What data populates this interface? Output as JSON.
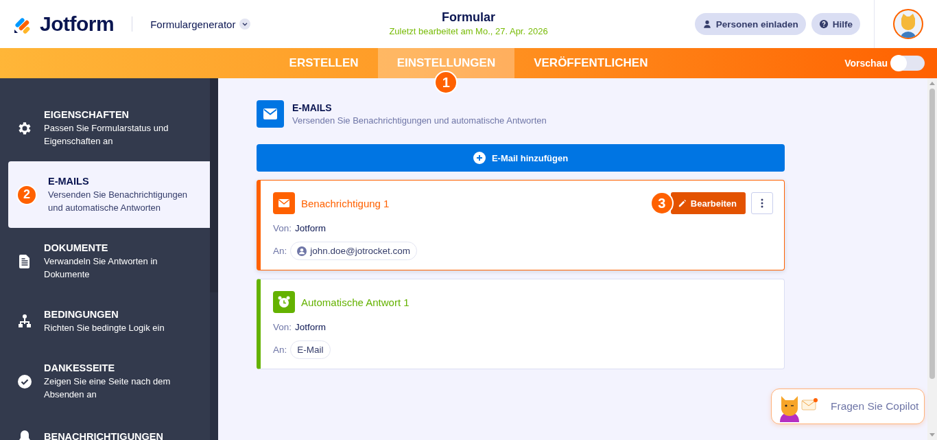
{
  "header": {
    "logo": "Jotform",
    "builder_menu": "Formulargenerator",
    "title": "Formular",
    "last_edited": "Zuletzt bearbeitet am Mo., 27. Apr. 2026",
    "buttons": [
      {
        "kind": "invite",
        "label": "Personen einladen"
      },
      {
        "kind": "help",
        "label": "Hilfe"
      }
    ]
  },
  "tabs": [
    {
      "label": "ERSTELLEN",
      "selected": false
    },
    {
      "label": "EINSTELLUNGEN",
      "selected": true,
      "step": "1"
    },
    {
      "label": "VERÖFFENTLICHEN",
      "selected": false
    }
  ],
  "preview": {
    "label": "Vorschau",
    "on": false
  },
  "sidebar": {
    "items": [
      {
        "kind": "gear",
        "title": "EIGENSCHAFTEN",
        "description": "Passen Sie Formularstatus und Eigenschaften an",
        "selected": false
      },
      {
        "title": "E-MAILS",
        "description": "Versenden Sie Benachrichtigungen und automatische Antworten",
        "selected": true,
        "step": "2"
      },
      {
        "kind": "document",
        "title": "DOKUMENTE",
        "description": "Verwandeln Sie Antworten in Dokumente",
        "selected": false
      },
      {
        "kind": "logic",
        "title": "BEDINGUNGEN",
        "description": "Richten Sie bedingte Logik ein",
        "selected": false
      },
      {
        "kind": "check",
        "title": "DANKESSEITE",
        "description": "Zeigen Sie eine Seite nach dem Absenden an",
        "selected": false
      },
      {
        "kind": "bell",
        "title": "BENACHRICHTIGUNGEN",
        "selected": false
      }
    ]
  },
  "section": {
    "title": "E-MAILS",
    "description": "Versenden Sie Benachrichtigungen und automatische Antworten",
    "add_button": "E-Mail hinzufügen"
  },
  "emails": [
    {
      "kind": "notification",
      "name": "Benachrichtigung 1",
      "color": "#ff6100",
      "highlighted": true,
      "from_label": "Von:",
      "from": "Jotform",
      "to_label": "An:",
      "to": "john.doe@jotrocket.com",
      "to_person": true,
      "edit_button": "Bearbeiten",
      "edit_step": "3"
    },
    {
      "kind": "autoresponder",
      "name": "Automatische Antwort 1",
      "color": "#64b200",
      "highlighted": false,
      "from_label": "Von:",
      "from": "Jotform",
      "to_label": "An:",
      "to": "E-Mail",
      "to_person": false
    }
  ],
  "copilot": {
    "label": "Fragen Sie Copilot"
  }
}
